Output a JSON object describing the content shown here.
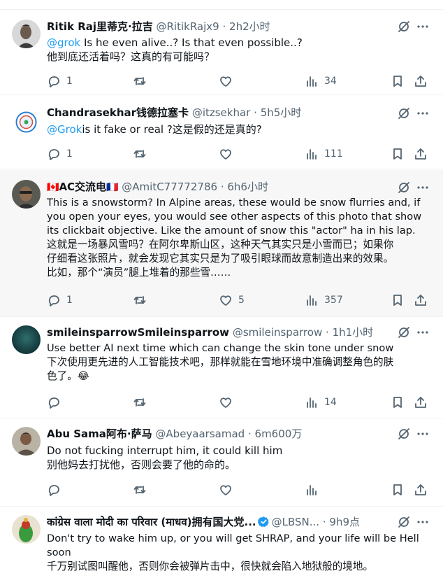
{
  "replies": [
    {
      "name": "Ritik Raj里蒂克·拉吉",
      "handle": "@RitikRajx9",
      "time": "2h2小时",
      "verified": false,
      "flag_left": "",
      "flag_right": "",
      "lines": [
        {
          "mention": "@grok",
          "text": "  Is he even alive..? Is that even possible..?"
        },
        {
          "mention": "",
          "text": "他到底还活着吗？这真的有可能吗？"
        }
      ],
      "stats": {
        "replies": "1",
        "reposts": "",
        "likes": "",
        "views": "34"
      }
    },
    {
      "name": "Chandrasekhar钱德拉塞卡",
      "handle": "@itzsekhar",
      "time": "5h5小时",
      "verified": false,
      "flag_left": "",
      "flag_right": "",
      "lines": [
        {
          "mention": "@Grok",
          "text": "is it fake or real ?这是假的还是真的?"
        }
      ],
      "stats": {
        "replies": "1",
        "reposts": "",
        "likes": "",
        "views": "111"
      }
    },
    {
      "name": "AC交流电",
      "handle": "@AmitC77772786",
      "time": "6h6小时",
      "verified": false,
      "flag_left": "🇨🇦",
      "flag_right": "🇫🇷",
      "lines": [
        {
          "mention": "",
          "text": "This is a snowstorm? In Alpine areas, these would be snow flurries and, if"
        },
        {
          "mention": "",
          "text": "you open your eyes, you would see other aspects of this photo that show"
        },
        {
          "mention": "",
          "text": "its clickbait objective. Like the amount of snow this \"actor\" ha in his lap."
        },
        {
          "mention": "",
          "text": "这就是一场暴风雪吗？在阿尔卑斯山区，这种天气其实只是小雪而已；如果你"
        },
        {
          "mention": "",
          "text": "仔细看这张照片，就会发现它其实只是为了吸引眼球而故意制造出来的效果。"
        },
        {
          "mention": "",
          "text": "比如，那个“演员”腿上堆着的那些雪……"
        }
      ],
      "stats": {
        "replies": "1",
        "reposts": "",
        "likes": "5",
        "views": "357"
      }
    },
    {
      "name": "smileinsparrowSmileinsparrow",
      "handle": "@smileinsparrow",
      "time": "1h1小时",
      "verified": false,
      "flag_left": "",
      "flag_right": "",
      "lines": [
        {
          "mention": "",
          "text": "Use better AI next time which can change the skin tone under snow"
        },
        {
          "mention": "",
          "text": "下次使用更先进的人工智能技术吧，那样就能在雪地环境中准确调整角色的肤"
        },
        {
          "mention": "",
          "text": "色了。😂"
        }
      ],
      "stats": {
        "replies": "",
        "reposts": "",
        "likes": "",
        "views": "14"
      }
    },
    {
      "name": "Abu Sama阿布·萨马",
      "handle": "@Abeyaarsamad",
      "time": "6m600万",
      "verified": false,
      "flag_left": "",
      "flag_right": "",
      "lines": [
        {
          "mention": "",
          "text": "Do not fucking interrupt him, it could kill him"
        },
        {
          "mention": "",
          "text": "别他妈去打扰他，否则会要了他的命的。"
        }
      ],
      "stats": {
        "replies": "",
        "reposts": "",
        "likes": "",
        "views": ""
      }
    },
    {
      "name": "कांग्रेस वाला मोदी का परिवार (माधव)拥有国大党...",
      "handle": "@LBSN...",
      "time": "9h9点",
      "verified": true,
      "flag_left": "",
      "flag_right": "",
      "lines": [
        {
          "mention": "",
          "text": "Don't try to wake him up, or you will get SHRAP, and your life will be Hell"
        },
        {
          "mention": "",
          "text": "soon"
        },
        {
          "mention": "",
          "text": "千万别试图叫醒他，否则你会被弹片击中，很快就会陷入地狱般的境地。"
        }
      ],
      "stats": {
        "replies": "",
        "reposts": "",
        "likes": "",
        "views": ""
      }
    }
  ],
  "separator": "·",
  "icons": [
    "grok-icon",
    "more-icon",
    "reply-icon",
    "repost-icon",
    "like-icon",
    "views-icon",
    "bookmark-icon",
    "share-icon",
    "verified-badge-icon"
  ],
  "colors": {
    "text": "#0f1419",
    "secondary": "#536471",
    "link": "#1d9bf0",
    "highlight_bg": "#f7f7f7",
    "divider": "#eff3f4"
  }
}
